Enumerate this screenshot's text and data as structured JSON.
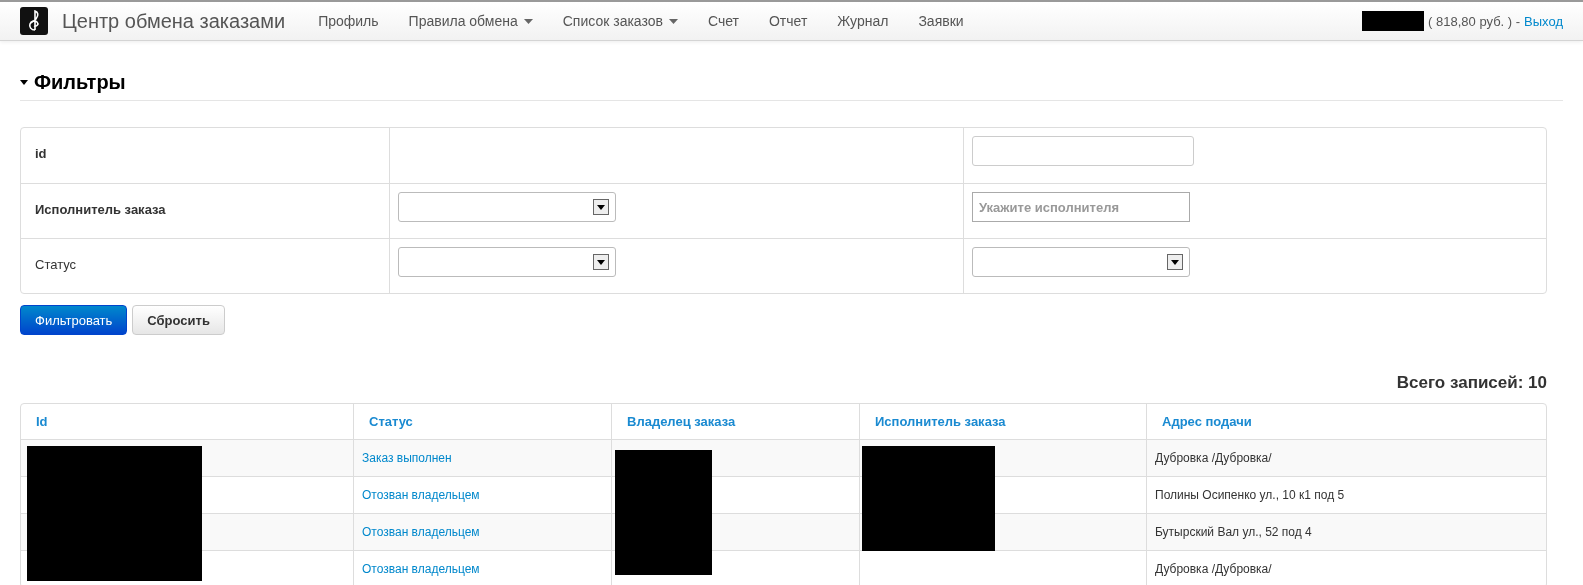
{
  "navbar": {
    "brand": "Центр обмена заказами",
    "items": [
      {
        "label": "Профиль",
        "dropdown": false
      },
      {
        "label": "Правила обмена",
        "dropdown": true
      },
      {
        "label": "Список заказов",
        "dropdown": true
      },
      {
        "label": "Счет",
        "dropdown": false
      },
      {
        "label": "Отчет",
        "dropdown": false
      },
      {
        "label": "Журнал",
        "dropdown": false
      },
      {
        "label": "Заявки",
        "dropdown": false
      }
    ],
    "balance": "( 818,80 руб. ) -",
    "logout": "Выход"
  },
  "filters": {
    "title": "Фильтры",
    "expanded": true,
    "rows": [
      {
        "label": "id",
        "bold": true,
        "middle": {
          "kind": "none"
        },
        "right": {
          "kind": "input"
        }
      },
      {
        "label": "Исполнитель заказа",
        "bold": true,
        "middle": {
          "kind": "select"
        },
        "right": {
          "kind": "input",
          "placeholder": "Укажите исполнителя"
        }
      },
      {
        "label": "Статус",
        "bold": false,
        "middle": {
          "kind": "select"
        },
        "right": {
          "kind": "select"
        }
      }
    ],
    "buttons": [
      {
        "label": "Фильтровать",
        "kind": "primary"
      },
      {
        "label": "Сбросить",
        "kind": "default"
      }
    ]
  },
  "total": "Всего записей: 10",
  "table": {
    "columns": [
      "Id",
      "Статус",
      "Владелец заказа",
      "Исполнитель заказа",
      "Адрес подачи"
    ],
    "rows": [
      {
        "status": "Заказ выполнен",
        "address": "Дубровка /Дубровка/"
      },
      {
        "status": "Отозван владельцем",
        "address": "Полины Осипенко ул., 10 к1 под 5"
      },
      {
        "status": "Отозван владельцем",
        "address": "Бутырский Вал ул., 52 под 4"
      },
      {
        "status": "Отозван владельцем",
        "address": "Дубровка /Дубровка/"
      }
    ]
  }
}
